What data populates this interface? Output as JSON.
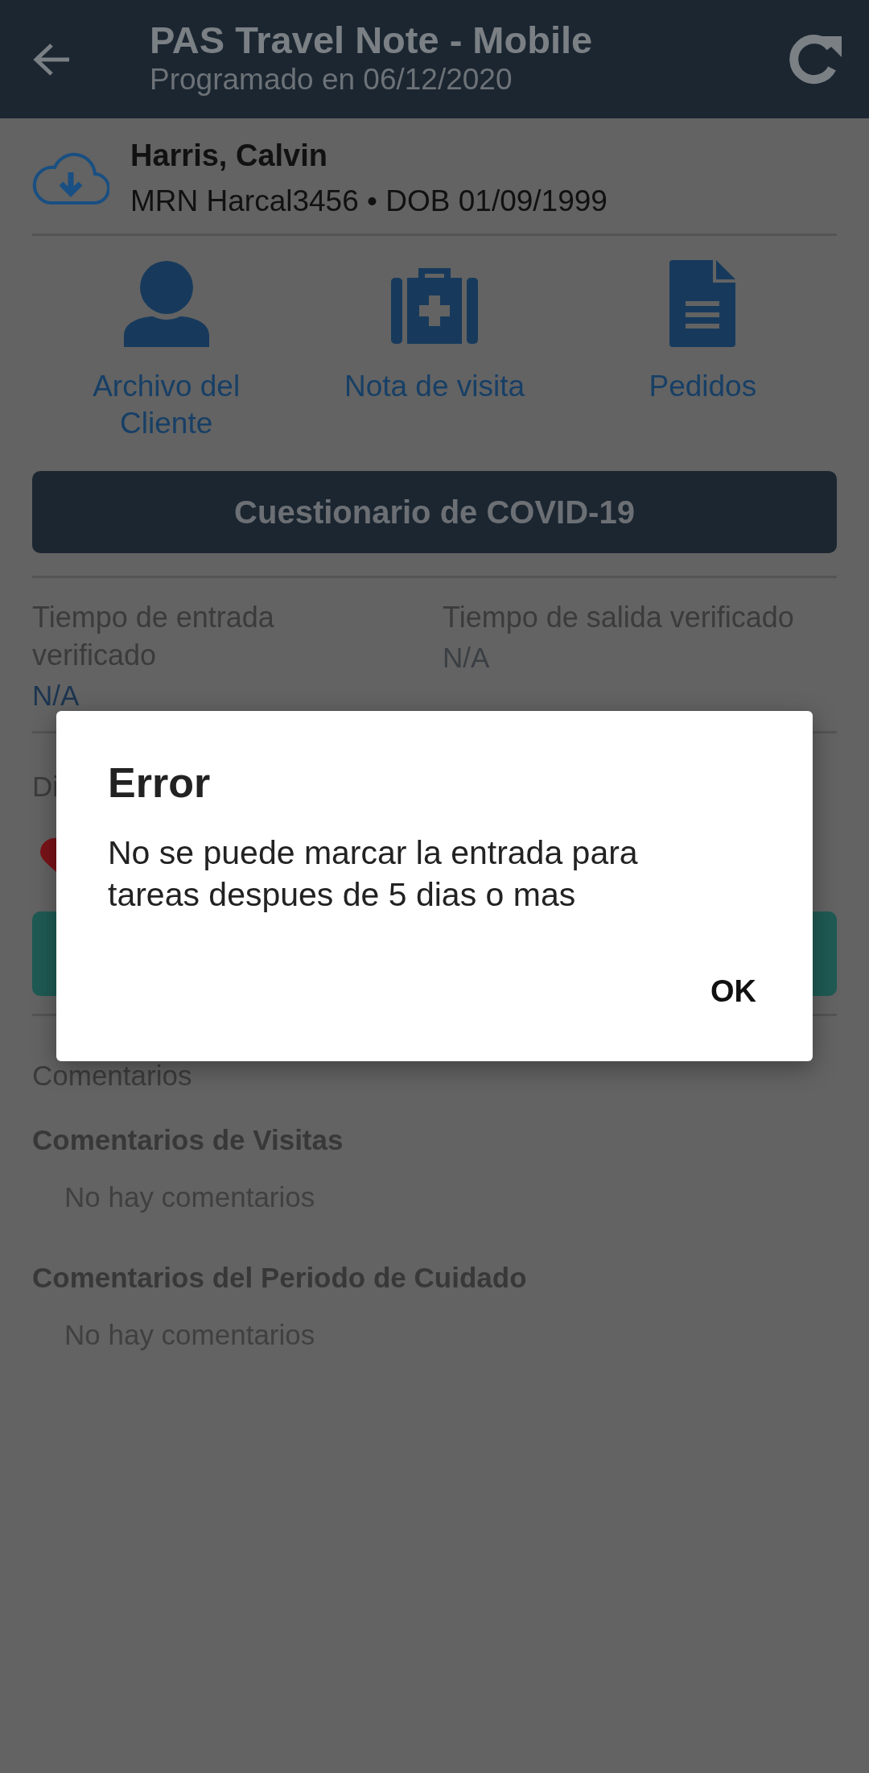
{
  "header": {
    "title": "PAS Travel Note - Mobile",
    "subtitle": "Programado en 06/12/2020"
  },
  "patient": {
    "name": "Harris, Calvin",
    "details": "MRN Harcal3456 • DOB 01/09/1999"
  },
  "actions": [
    {
      "kind": "person",
      "label": "Archivo del Cliente"
    },
    {
      "kind": "medkit",
      "label": "Nota de visita"
    },
    {
      "kind": "document",
      "label": "Pedidos"
    }
  ],
  "covid_button": "Cuestionario de COVID-19",
  "times": [
    {
      "label": "Tiempo de entrada verificado",
      "value": "N/A"
    },
    {
      "label": "Tiempo de salida verificado",
      "value": "N/A"
    }
  ],
  "section_label": "Di",
  "comments": {
    "label": "Comentarios",
    "groups": [
      {
        "title": "Comentarios de Visitas",
        "empty": "No hay comentarios"
      },
      {
        "title": "Comentarios del Periodo de Cuidado",
        "empty": "No hay comentarios"
      }
    ]
  },
  "dialog": {
    "title": "Error",
    "message": "No se puede marcar la entrada para tareas despues de 5 dias o mas",
    "button": "OK"
  }
}
